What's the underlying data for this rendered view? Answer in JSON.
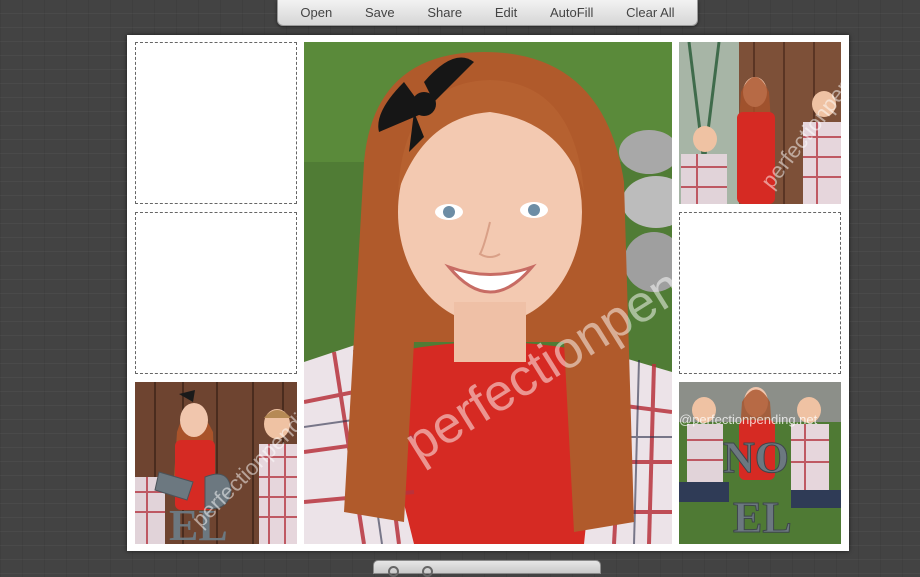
{
  "toolbar": {
    "open": "Open",
    "save": "Save",
    "share": "Share",
    "edit": "Edit",
    "autofill": "AutoFill",
    "clear_all": "Clear All"
  },
  "watermarks": {
    "main": "perfectionpending.net",
    "top_right": "perfectionpending.net",
    "bottom_left": "perfectionpending.net",
    "bottom_right": "@perfectionpending.net"
  },
  "sign_letters": {
    "bottom_left": "EL",
    "bottom_right_top": "NO",
    "bottom_right_bottom": "EL"
  },
  "colors": {
    "accent_red": "#d62a23",
    "plaid_light": "#e9dfe3",
    "grass": "#4f7a34",
    "wood": "#7b4a30",
    "hair": "#b65a2a",
    "sign_gray": "#6c7880"
  }
}
